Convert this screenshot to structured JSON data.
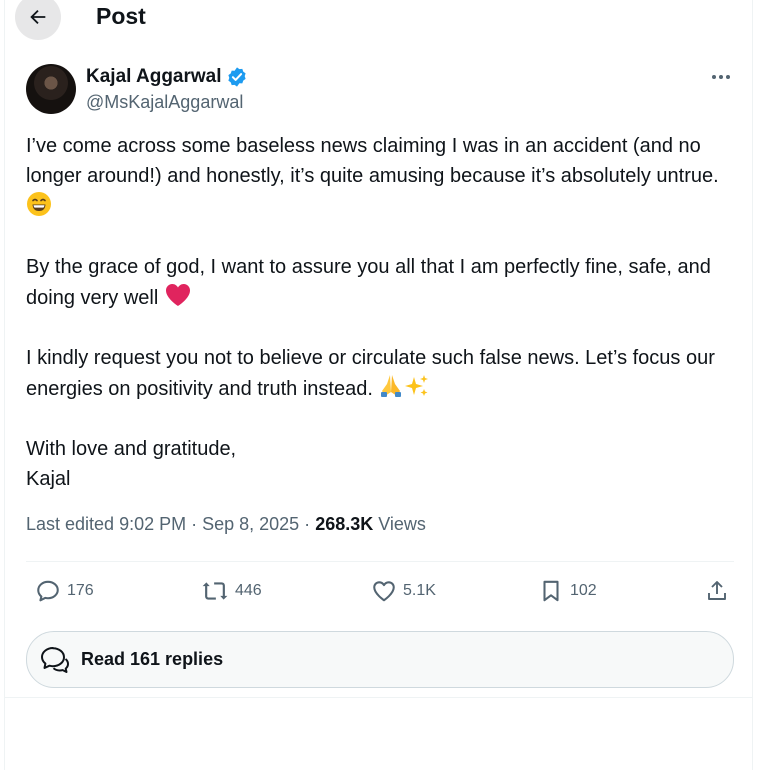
{
  "header": {
    "title": "Post"
  },
  "author": {
    "name": "Kajal Aggarwal",
    "handle": "@MsKajalAggarwal"
  },
  "tweet": {
    "paragraphs": [
      "I’ve come across some baseless news claiming I was in an accident (and no longer around!) and honestly, it’s quite amusing because it’s absolutely untrue.",
      "By the grace of god, I want to assure you all that I am perfectly fine, safe, and doing very well",
      "I kindly request you not to believe or circulate such false news. Let’s focus our energies on positivity and truth instead.",
      "With love and gratitude,\nKajal"
    ],
    "emojis": {
      "p1": "grinning-face-with-smiling-eyes",
      "p2": "red-heart",
      "p3": [
        "folded-hands",
        "sparkles"
      ]
    }
  },
  "meta": {
    "edited": "Last edited 9:02 PM · Sep 8, 2025 · ",
    "views_count": "268.3K",
    "views_label": " Views"
  },
  "stats": {
    "replies": "176",
    "reposts": "446",
    "likes": "5.1K",
    "bookmarks": "102"
  },
  "read_replies": {
    "label": "Read 161 replies"
  },
  "colors": {
    "verified": "#1d9bf0",
    "text": "#0f1419",
    "secondary": "#536471",
    "heart": "#e0245e"
  }
}
